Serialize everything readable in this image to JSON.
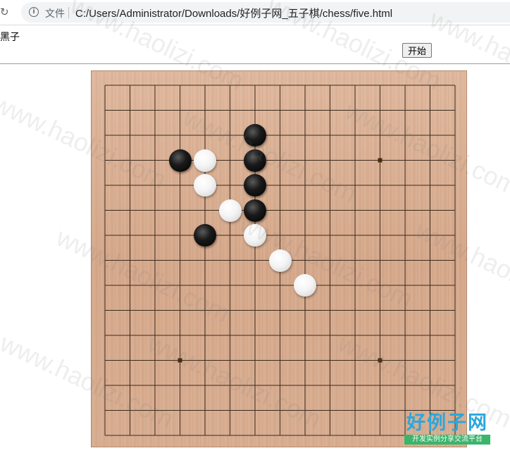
{
  "browser": {
    "file_label": "文件",
    "url": "C:/Users/Administrator/Downloads/好例子网_五子棋/chess/five.html",
    "reload_icon": "reload-icon",
    "info_icon": "info-icon"
  },
  "page": {
    "turn_label": "黑子",
    "start_button": "开始"
  },
  "board": {
    "grid_size": 15,
    "star_points": [
      [
        11,
        3
      ],
      [
        3,
        11
      ],
      [
        11,
        11
      ]
    ],
    "stones": [
      {
        "color": "black",
        "col": 6,
        "row": 2
      },
      {
        "color": "black",
        "col": 3,
        "row": 3
      },
      {
        "color": "white",
        "col": 4,
        "row": 3
      },
      {
        "color": "black",
        "col": 6,
        "row": 3
      },
      {
        "color": "white",
        "col": 4,
        "row": 4
      },
      {
        "color": "black",
        "col": 6,
        "row": 4
      },
      {
        "color": "white",
        "col": 5,
        "row": 5
      },
      {
        "color": "black",
        "col": 6,
        "row": 5
      },
      {
        "color": "black",
        "col": 4,
        "row": 6
      },
      {
        "color": "white",
        "col": 6,
        "row": 6
      },
      {
        "color": "white",
        "col": 7,
        "row": 7
      },
      {
        "color": "white",
        "col": 8,
        "row": 8
      }
    ],
    "colors": {
      "line": "#3b2a1e",
      "black_stone": "#000000",
      "white_stone": "#f4f4f4"
    }
  },
  "watermark": {
    "text": "www.haolizi.com"
  },
  "logo": {
    "main": "好例子网",
    "sub": "开发实例分享交流平台"
  }
}
